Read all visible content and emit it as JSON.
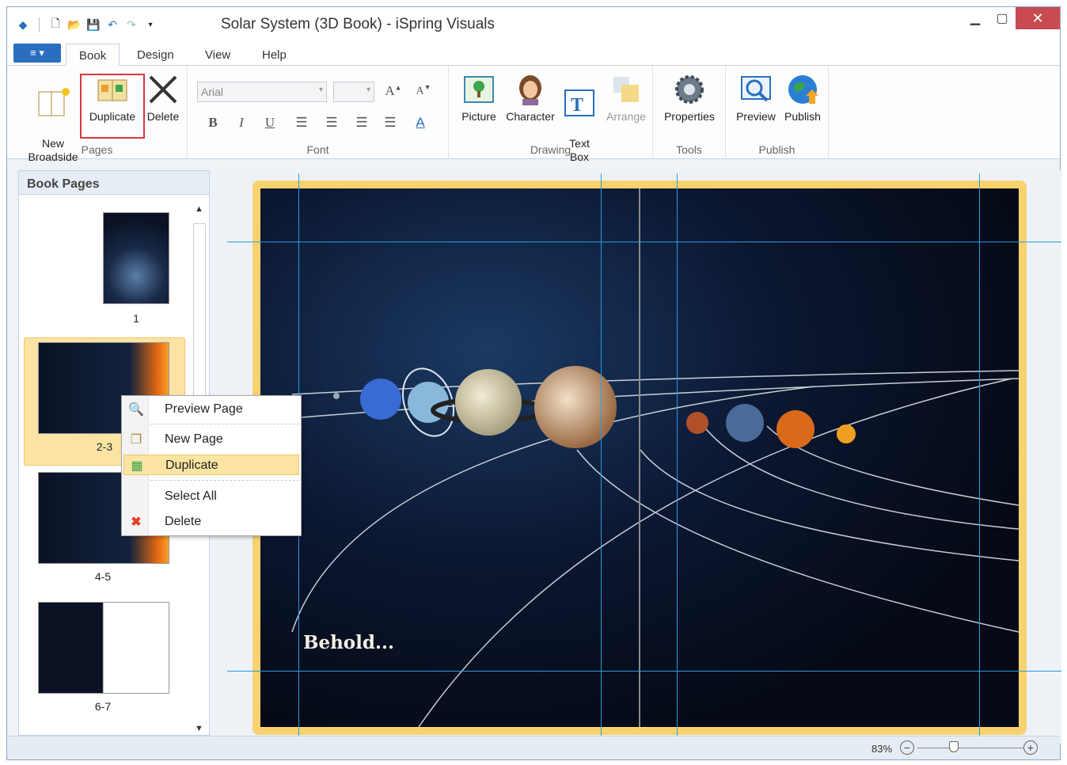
{
  "window": {
    "title": "Solar System (3D Book) - iSpring Visuals"
  },
  "ribbon_tabs": [
    "Book",
    "Design",
    "View",
    "Help"
  ],
  "groups": {
    "pages": {
      "label": "Pages",
      "new": "New\nBroadside",
      "duplicate": "Duplicate",
      "delete": "Delete"
    },
    "font": {
      "label": "Font",
      "font_name": "Arial",
      "bold": "B",
      "italic": "I",
      "underline": "U",
      "font_color": "A"
    },
    "drawing": {
      "label": "Drawing",
      "picture": "Picture",
      "character": "Character",
      "text_box": "Text\nBox",
      "arrange": "Arrange"
    },
    "tools": {
      "label": "Tools",
      "properties": "Properties"
    },
    "publish": {
      "label": "Publish",
      "preview": "Preview",
      "publish": "Publish"
    }
  },
  "left_pane": {
    "title": "Book Pages",
    "pages": [
      "1",
      "2-3",
      "4-5",
      "6-7"
    ]
  },
  "context_menu": {
    "items": [
      "Preview Page",
      "New Page",
      "Duplicate",
      "Select All",
      "Delete"
    ],
    "highlighted": "Duplicate"
  },
  "canvas": {
    "text": "Behold..."
  },
  "status": {
    "zoom": "83%"
  },
  "colors": {
    "accent": "#2a6fbf",
    "selection": "#fbe4a3",
    "guide": "#2a9be0",
    "book_border": "#f7d26f",
    "highlight_red": "#d9363e"
  }
}
